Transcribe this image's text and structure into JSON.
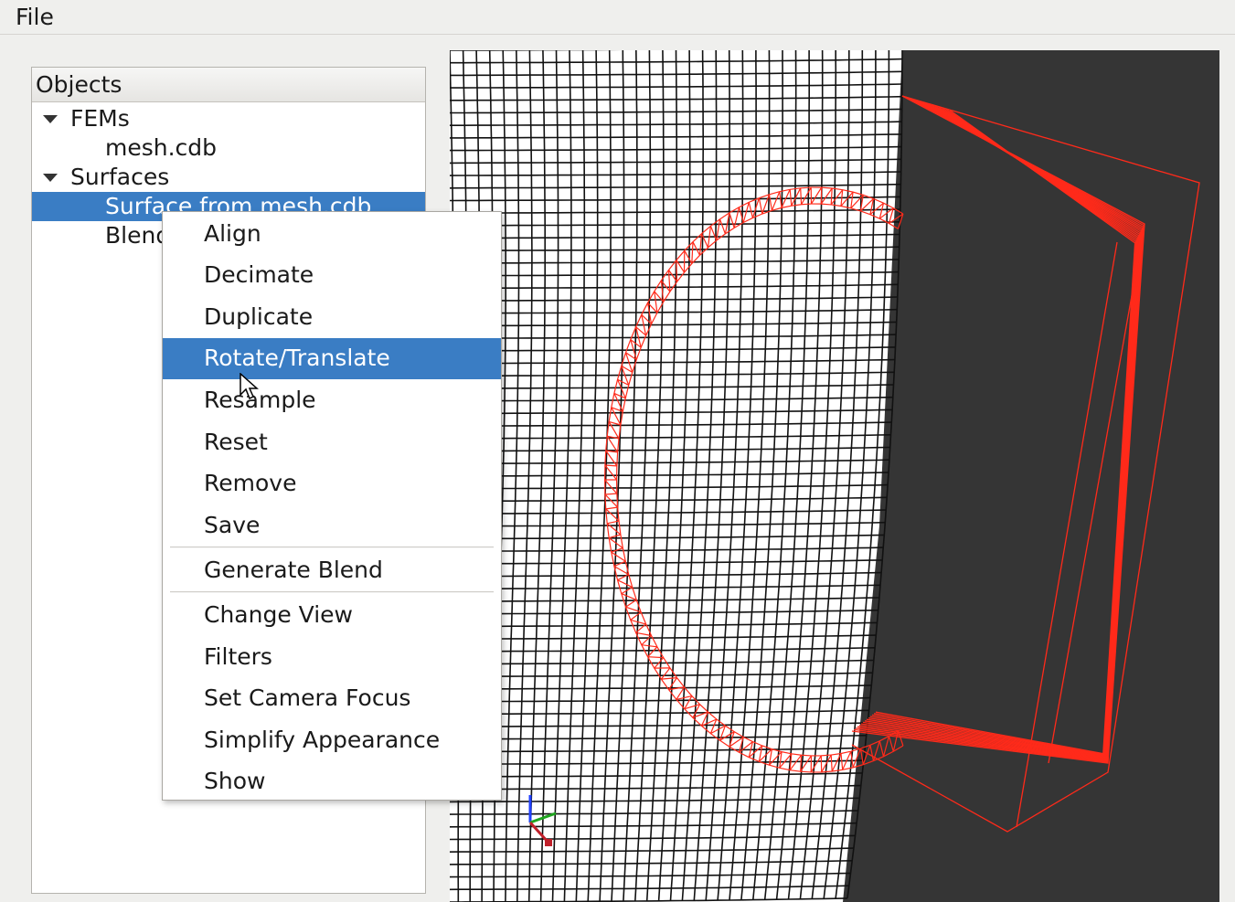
{
  "menubar": {
    "file_label": "File"
  },
  "objects_panel": {
    "header": "Objects",
    "tree": {
      "fems_label": "FEMs",
      "mesh_label": "mesh.cdb",
      "surfaces_label": "Surfaces",
      "surface_item_label": "Surface from mesh.cdb",
      "blend_item_label": "Blend"
    }
  },
  "context_menu": {
    "items": [
      "Align",
      "Decimate",
      "Duplicate",
      "Rotate/Translate",
      "Resample",
      "Reset",
      "Remove",
      "Save",
      "Generate Blend",
      "Change View",
      "Filters",
      "Set Camera Focus",
      "Simplify Appearance",
      "Show"
    ],
    "highlighted": "Rotate/Translate"
  },
  "viewport": {
    "mesh_color": "#000000",
    "surface_color": "#ff2a1a",
    "background_dark": "#353535"
  }
}
